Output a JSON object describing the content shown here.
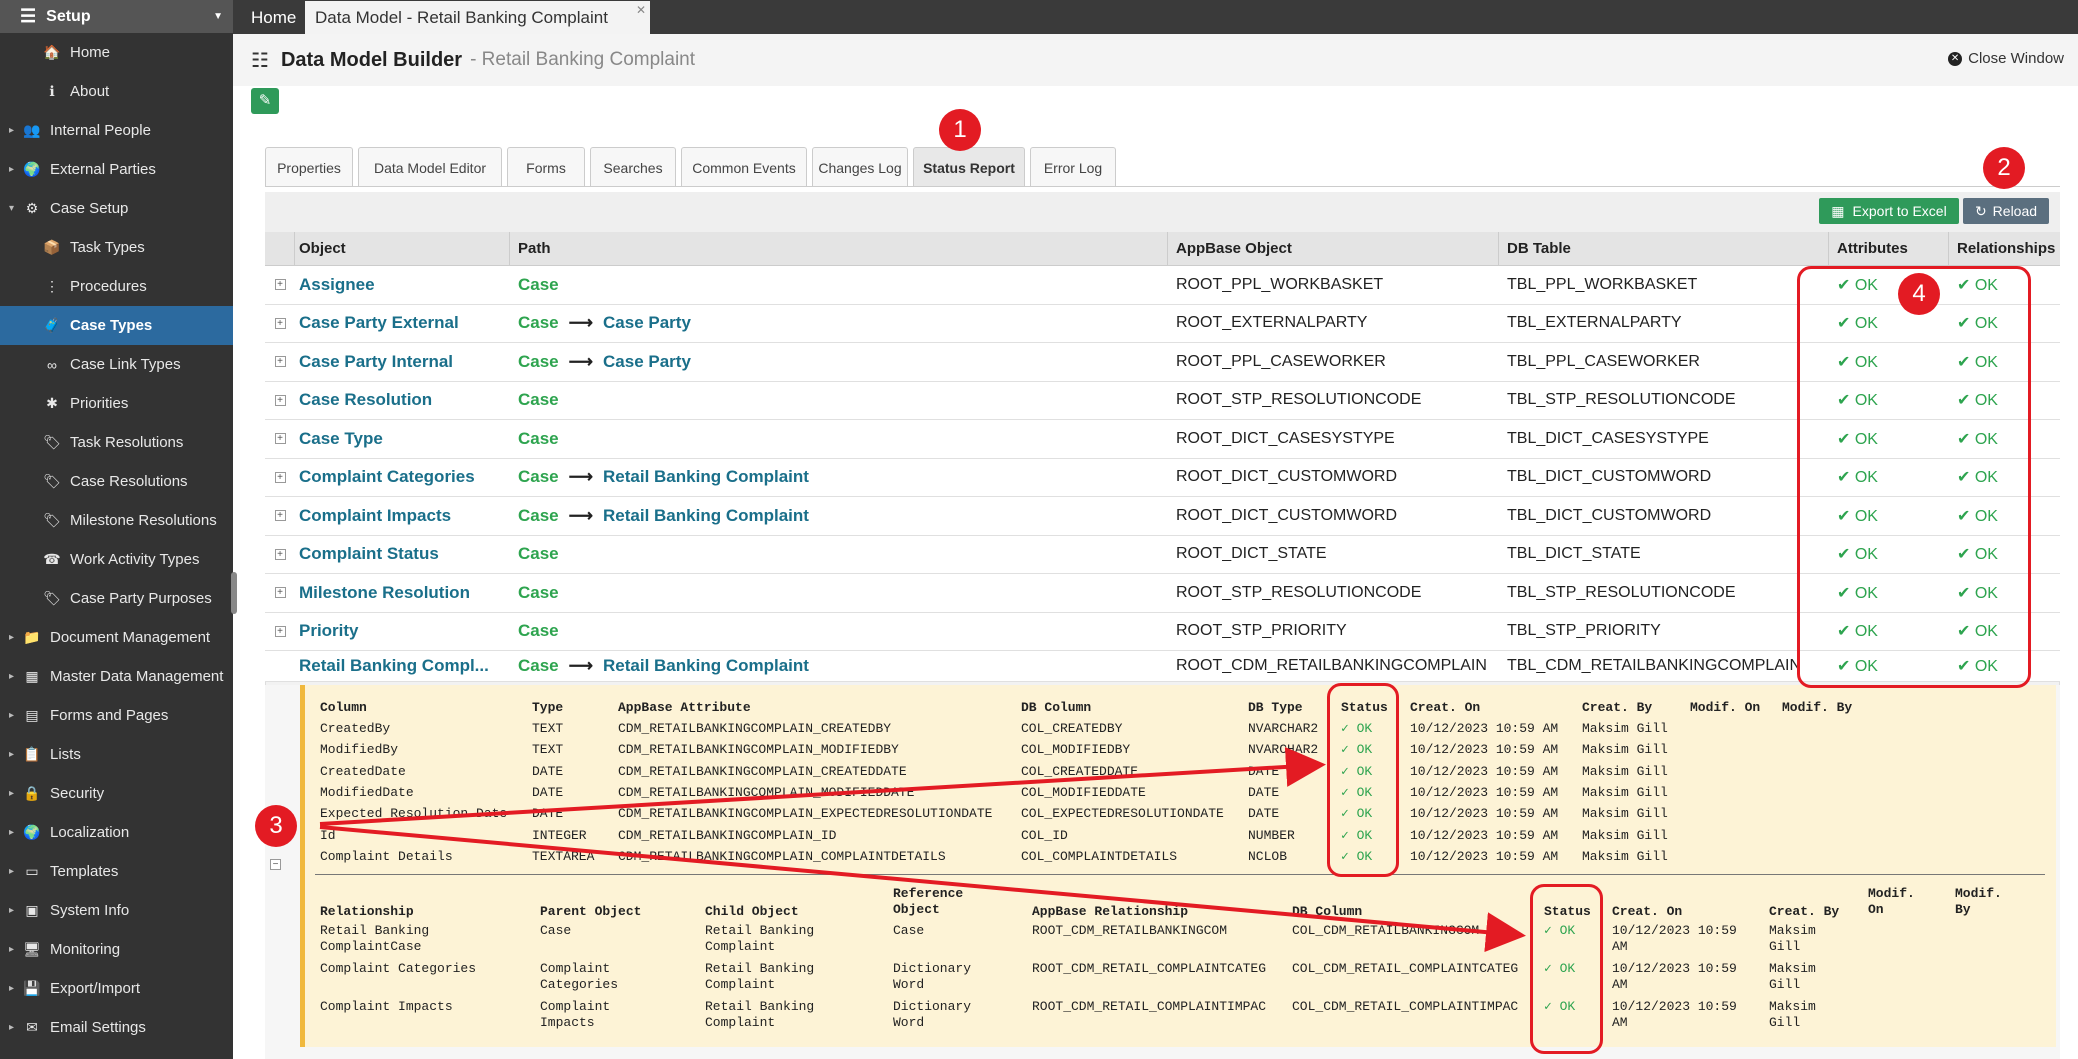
{
  "sidebar": {
    "title": "Setup",
    "items": [
      {
        "label": "Home",
        "icon": "home-icon",
        "glyph": "🏠",
        "level": 1,
        "expandable": false
      },
      {
        "label": "About",
        "icon": "info-icon",
        "glyph": "ℹ",
        "level": 1,
        "expandable": false
      },
      {
        "label": "Internal People",
        "icon": "people-icon",
        "glyph": "👥",
        "level": 0,
        "expandable": true
      },
      {
        "label": "External Parties",
        "icon": "globe-icon",
        "glyph": "🌍",
        "level": 0,
        "expandable": true
      },
      {
        "label": "Case Setup",
        "icon": "case-setup-icon",
        "glyph": "⚙",
        "level": 0,
        "expandable": true,
        "expanded": true
      },
      {
        "label": "Task Types",
        "icon": "task-types-icon",
        "glyph": "📦",
        "level": 1,
        "expandable": false
      },
      {
        "label": "Procedures",
        "icon": "procedures-icon",
        "glyph": "⋮",
        "level": 1,
        "expandable": false
      },
      {
        "label": "Case Types",
        "icon": "case-types-icon",
        "glyph": "🧳",
        "level": 1,
        "expandable": false,
        "active": true
      },
      {
        "label": "Case Link Types",
        "icon": "link-icon",
        "glyph": "∞",
        "level": 1,
        "expandable": false
      },
      {
        "label": "Priorities",
        "icon": "priorities-icon",
        "glyph": "✱",
        "level": 1,
        "expandable": false
      },
      {
        "label": "Task Resolutions",
        "icon": "tag-icon",
        "glyph": "🏷",
        "level": 1,
        "expandable": false
      },
      {
        "label": "Case Resolutions",
        "icon": "tag-icon",
        "glyph": "🏷",
        "level": 1,
        "expandable": false
      },
      {
        "label": "Milestone Resolutions",
        "icon": "tag-icon",
        "glyph": "🏷",
        "level": 1,
        "expandable": false
      },
      {
        "label": "Work Activity Types",
        "icon": "phone-icon",
        "glyph": "☎",
        "level": 1,
        "expandable": false
      },
      {
        "label": "Case Party Purposes",
        "icon": "tag-icon",
        "glyph": "🏷",
        "level": 1,
        "expandable": false
      },
      {
        "label": "Document Management",
        "icon": "folder-icon",
        "glyph": "📁",
        "level": 0,
        "expandable": true
      },
      {
        "label": "Master Data Management",
        "icon": "grid-icon",
        "glyph": "▦",
        "level": 0,
        "expandable": true
      },
      {
        "label": "Forms and Pages",
        "icon": "form-icon",
        "glyph": "▤",
        "level": 0,
        "expandable": true
      },
      {
        "label": "Lists",
        "icon": "list-icon",
        "glyph": "📋",
        "level": 0,
        "expandable": true
      },
      {
        "label": "Security",
        "icon": "lock-icon",
        "glyph": "🔒",
        "level": 0,
        "expandable": true
      },
      {
        "label": "Localization",
        "icon": "globe-icon",
        "glyph": "🌍",
        "level": 0,
        "expandable": true
      },
      {
        "label": "Templates",
        "icon": "template-icon",
        "glyph": "▭",
        "level": 0,
        "expandable": true
      },
      {
        "label": "System Info",
        "icon": "terminal-icon",
        "glyph": "▣",
        "level": 0,
        "expandable": true
      },
      {
        "label": "Monitoring",
        "icon": "monitor-icon",
        "glyph": "🖥",
        "level": 0,
        "expandable": true
      },
      {
        "label": "Export/Import",
        "icon": "save-icon",
        "glyph": "💾",
        "level": 0,
        "expandable": true
      },
      {
        "label": "Email Settings",
        "icon": "email-icon",
        "glyph": "✉",
        "level": 0,
        "expandable": true
      }
    ]
  },
  "top_tabs": {
    "home": "Home",
    "current": "Data Model - Retail Banking Complaint"
  },
  "header": {
    "title": "Data Model Builder",
    "subtitle": "- Retail Banking Complaint",
    "close": "Close Window"
  },
  "tabs": [
    "Properties",
    "Data Model Editor",
    "Forms",
    "Searches",
    "Common Events",
    "Changes Log",
    "Status Report",
    "Error Log"
  ],
  "active_tab": "Status Report",
  "toolbar": {
    "export": "Export to Excel",
    "reload": "Reload"
  },
  "grid": {
    "columns": [
      "Object",
      "Path",
      "AppBase Object",
      "DB Table",
      "Attributes",
      "Relationships"
    ],
    "rows": [
      {
        "object": "Assignee",
        "path": [
          "Case"
        ],
        "app": "ROOT_PPL_WORKBASKET",
        "db": "TBL_PPL_WORKBASKET",
        "attributes": "OK",
        "relationships": "OK"
      },
      {
        "object": "Case Party External",
        "path": [
          "Case",
          "Case Party"
        ],
        "app": "ROOT_EXTERNALPARTY",
        "db": "TBL_EXTERNALPARTY",
        "attributes": "OK",
        "relationships": "OK"
      },
      {
        "object": "Case Party Internal",
        "path": [
          "Case",
          "Case Party"
        ],
        "app": "ROOT_PPL_CASEWORKER",
        "db": "TBL_PPL_CASEWORKER",
        "attributes": "OK",
        "relationships": "OK"
      },
      {
        "object": "Case Resolution",
        "path": [
          "Case"
        ],
        "app": "ROOT_STP_RESOLUTIONCODE",
        "db": "TBL_STP_RESOLUTIONCODE",
        "attributes": "OK",
        "relationships": "OK"
      },
      {
        "object": "Case Type",
        "path": [
          "Case"
        ],
        "app": "ROOT_DICT_CASESYSTYPE",
        "db": "TBL_DICT_CASESYSTYPE",
        "attributes": "OK",
        "relationships": "OK"
      },
      {
        "object": "Complaint Categories",
        "path": [
          "Case",
          "Retail Banking Complaint"
        ],
        "app": "ROOT_DICT_CUSTOMWORD",
        "db": "TBL_DICT_CUSTOMWORD",
        "attributes": "OK",
        "relationships": "OK"
      },
      {
        "object": "Complaint Impacts",
        "path": [
          "Case",
          "Retail Banking Complaint"
        ],
        "app": "ROOT_DICT_CUSTOMWORD",
        "db": "TBL_DICT_CUSTOMWORD",
        "attributes": "OK",
        "relationships": "OK"
      },
      {
        "object": "Complaint Status",
        "path": [
          "Case"
        ],
        "app": "ROOT_DICT_STATE",
        "db": "TBL_DICT_STATE",
        "attributes": "OK",
        "relationships": "OK"
      },
      {
        "object": "Milestone Resolution",
        "path": [
          "Case"
        ],
        "app": "ROOT_STP_RESOLUTIONCODE",
        "db": "TBL_STP_RESOLUTIONCODE",
        "attributes": "OK",
        "relationships": "OK"
      },
      {
        "object": "Priority",
        "path": [
          "Case"
        ],
        "app": "ROOT_STP_PRIORITY",
        "db": "TBL_STP_PRIORITY",
        "attributes": "OK",
        "relationships": "OK"
      },
      {
        "object": "Retail Banking Compl...",
        "path": [
          "Case",
          "Retail Banking Complaint"
        ],
        "app": "ROOT_CDM_RETAILBANKINGCOMPLAIN",
        "db": "TBL_CDM_RETAILBANKINGCOMPLAIN",
        "attributes": "OK",
        "relationships": "OK"
      }
    ]
  },
  "attributes_table": {
    "headers": [
      "Column",
      "Type",
      "AppBase Attribute",
      "DB Column",
      "DB Type",
      "Status",
      "Creat. On",
      "Creat. By",
      "Modif. On",
      "Modif. By"
    ],
    "rows": [
      [
        "CreatedBy",
        "TEXT",
        "CDM_RETAILBANKINGCOMPLAIN_CREATEDBY",
        "COL_CREATEDBY",
        "NVARCHAR2",
        "✓ OK",
        "10/12/2023 10:59 AM",
        "Maksim Gill",
        "",
        ""
      ],
      [
        "ModifiedBy",
        "TEXT",
        "CDM_RETAILBANKINGCOMPLAIN_MODIFIEDBY",
        "COL_MODIFIEDBY",
        "NVARCHAR2",
        "✓ OK",
        "10/12/2023 10:59 AM",
        "Maksim Gill",
        "",
        ""
      ],
      [
        "CreatedDate",
        "DATE",
        "CDM_RETAILBANKINGCOMPLAIN_CREATEDDATE",
        "COL_CREATEDDATE",
        "DATE",
        "✓ OK",
        "10/12/2023 10:59 AM",
        "Maksim Gill",
        "",
        ""
      ],
      [
        "ModifiedDate",
        "DATE",
        "CDM_RETAILBANKINGCOMPLAIN_MODIFIEDDATE",
        "COL_MODIFIEDDATE",
        "DATE",
        "✓ OK",
        "10/12/2023 10:59 AM",
        "Maksim Gill",
        "",
        ""
      ],
      [
        "Expected Resolution Date",
        "DATE",
        "CDM_RETAILBANKINGCOMPLAIN_EXPECTEDRESOLUTIONDATE",
        "COL_EXPECTEDRESOLUTIONDATE",
        "DATE",
        "✓ OK",
        "10/12/2023 10:59 AM",
        "Maksim Gill",
        "",
        ""
      ],
      [
        "Id",
        "INTEGER",
        "CDM_RETAILBANKINGCOMPLAIN_ID",
        "COL_ID",
        "NUMBER",
        "✓ OK",
        "10/12/2023 10:59 AM",
        "Maksim Gill",
        "",
        ""
      ],
      [
        "Complaint Details",
        "TEXTAREA",
        "CDM_RETAILBANKINGCOMPLAIN_COMPLAINTDETAILS",
        "COL_COMPLAINTDETAILS",
        "NCLOB",
        "✓ OK",
        "10/12/2023 10:59 AM",
        "Maksim Gill",
        "",
        ""
      ]
    ]
  },
  "relationships_table": {
    "headers": [
      "Relationship",
      "Parent Object",
      "Child Object",
      "Reference Object",
      "AppBase Relationship",
      "DB Column",
      "Status",
      "Creat. On",
      "Creat. By",
      "Modif. On",
      "Modif. By"
    ],
    "rows": [
      [
        "Retail Banking ComplaintCase",
        "Case",
        "Retail Banking Complaint",
        "Case",
        "ROOT_CDM_RETAILBANKINGCOM",
        "COL_CDM_RETAILBANKINGCOM",
        "✓ OK",
        "10/12/2023 10:59 AM",
        "Maksim Gill",
        "",
        ""
      ],
      [
        "Complaint Categories",
        "Complaint Categories",
        "Retail Banking Complaint",
        "Dictionary Word",
        "ROOT_CDM_RETAIL_COMPLAINTCATEG",
        "COL_CDM_RETAIL_COMPLAINTCATEG",
        "✓ OK",
        "10/12/2023 10:59 AM",
        "Maksim Gill",
        "",
        ""
      ],
      [
        "Complaint Impacts",
        "Complaint Impacts",
        "Retail Banking Complaint",
        "Dictionary Word",
        "ROOT_CDM_RETAIL_COMPLAINTIMPAC",
        "COL_CDM_RETAIL_COMPLAINTIMPAC",
        "✓ OK",
        "10/12/2023 10:59 AM",
        "Maksim Gill",
        "",
        ""
      ]
    ]
  },
  "annotations": {
    "badges": [
      "1",
      "2",
      "3",
      "4"
    ],
    "color": "#e31b23"
  },
  "colors": {
    "ok_green": "#2ea44f",
    "link_teal": "#1a6f8a",
    "sidebar_bg": "#333333",
    "active_blue": "#2c6a9f",
    "detail_bg": "#fdf3d6"
  }
}
